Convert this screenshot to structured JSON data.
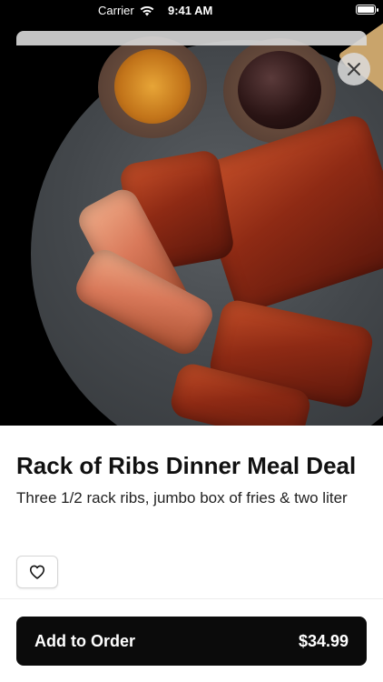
{
  "status_bar": {
    "carrier": "Carrier",
    "time": "9:41 AM"
  },
  "hero": {
    "image_description_icon": "food-photo"
  },
  "product": {
    "title": "Rack of Ribs Dinner Meal Deal",
    "description": "Three 1/2 rack ribs, jumbo box of fries & two liter"
  },
  "order_button": {
    "label": "Add to Order",
    "price": "$34.99"
  },
  "colors": {
    "button_bg": "#0b0b0b",
    "text": "#111111"
  }
}
